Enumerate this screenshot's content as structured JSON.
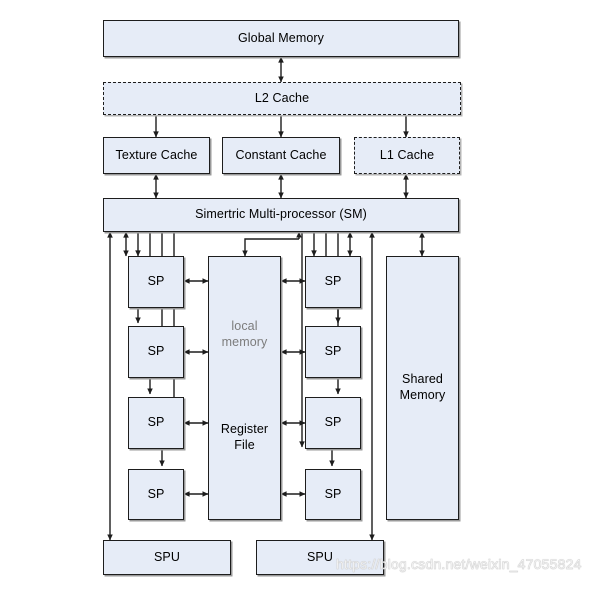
{
  "diagram": {
    "title": "GPU memory hierarchy and streaming multiprocessor block diagram",
    "colors": {
      "box_fill": "#e6ecf7",
      "box_border": "#1d1d1d",
      "shadow": "#9a9a9a",
      "arrow": "#1d1d1d",
      "muted_text": "#7c7c7c",
      "background": "#ffffff",
      "watermark": "#ffffff"
    },
    "nodes": {
      "global_memory": {
        "label": "Global Memory",
        "border": "solid"
      },
      "l2_cache": {
        "label": "L2 Cache",
        "border": "dashed"
      },
      "texture_cache": {
        "label": "Texture Cache",
        "border": "solid"
      },
      "constant_cache": {
        "label": "Constant Cache",
        "border": "solid"
      },
      "l1_cache": {
        "label": "L1 Cache",
        "border": "dashed"
      },
      "sm": {
        "label": "Simertric Multi-processor (SM)",
        "border": "solid"
      },
      "register_file": {
        "line1": "local",
        "line2": "memory",
        "line3": "Register",
        "line4": "File",
        "border": "solid"
      },
      "shared_memory": {
        "line1": "Shared",
        "line2": "Memory",
        "border": "solid"
      }
    },
    "sp_left": [
      {
        "label": "SP"
      },
      {
        "label": "SP"
      },
      {
        "label": "SP"
      },
      {
        "label": "SP"
      }
    ],
    "sp_right": [
      {
        "label": "SP"
      },
      {
        "label": "SP"
      },
      {
        "label": "SP"
      },
      {
        "label": "SP"
      }
    ],
    "spu": [
      {
        "label": "SPU"
      },
      {
        "label": "SPU"
      }
    ],
    "watermark": "https://blog.csdn.net/weixin_47055824"
  }
}
